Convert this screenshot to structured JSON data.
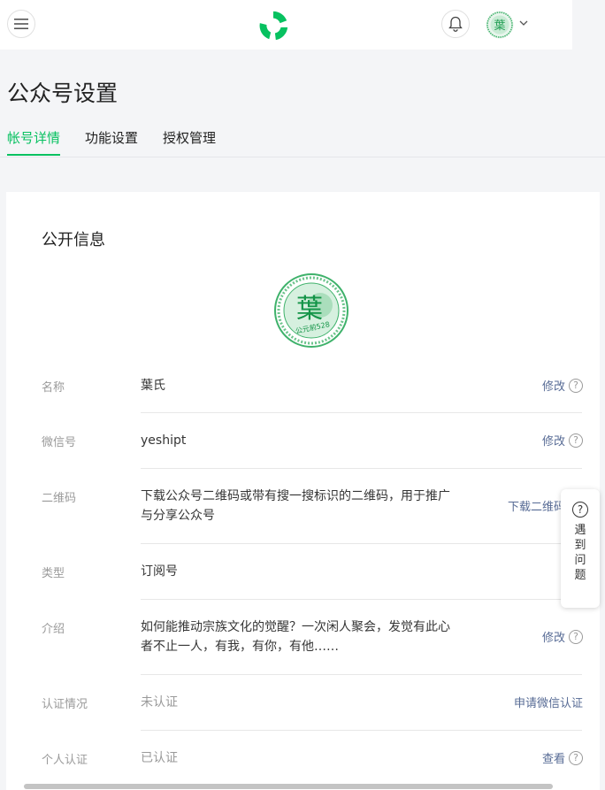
{
  "header": {
    "menu_icon": "hamburger-menu-icon",
    "logo_icon": "wechat-mp-logo-icon",
    "bell_icon": "bell-icon",
    "account_caret_icon": "chevron-down-icon",
    "avatar_text": "葉"
  },
  "page": {
    "title": "公众号设置"
  },
  "tabs": [
    {
      "label": "帐号详情",
      "active": true
    },
    {
      "label": "功能设置",
      "active": false
    },
    {
      "label": "授权管理",
      "active": false
    }
  ],
  "public_info": {
    "title": "公开信息",
    "avatar": {
      "char": "葉",
      "ring_text": "公元前528"
    },
    "rows": [
      {
        "label": "名称",
        "value": "葉氏",
        "action": "修改",
        "help": true
      },
      {
        "label": "微信号",
        "value": "yeshipt",
        "action": "修改",
        "help": true
      },
      {
        "label": "二维码",
        "value": "下载公众号二维码或带有搜一搜标识的二维码，用于推广与分享公众号",
        "action": "下载二维码",
        "help": false
      },
      {
        "label": "类型",
        "value": "订阅号",
        "action": "",
        "help": false
      },
      {
        "label": "介绍",
        "value": "如何能推动宗族文化的觉醒？一次闲人聚会，发觉有此心者不止一人，有我，有你，有他……",
        "action": "修改",
        "help": true
      },
      {
        "label": "认证情况",
        "value": "未认证",
        "action": "申请微信认证",
        "help": false
      },
      {
        "label": "个人认证",
        "value": "已认证",
        "action": "查看",
        "help": true
      }
    ]
  },
  "help_widget": {
    "icon": "question-circle-icon",
    "label": "遇到问题"
  },
  "colors": {
    "accent": "#07c160",
    "link": "#576b95"
  }
}
